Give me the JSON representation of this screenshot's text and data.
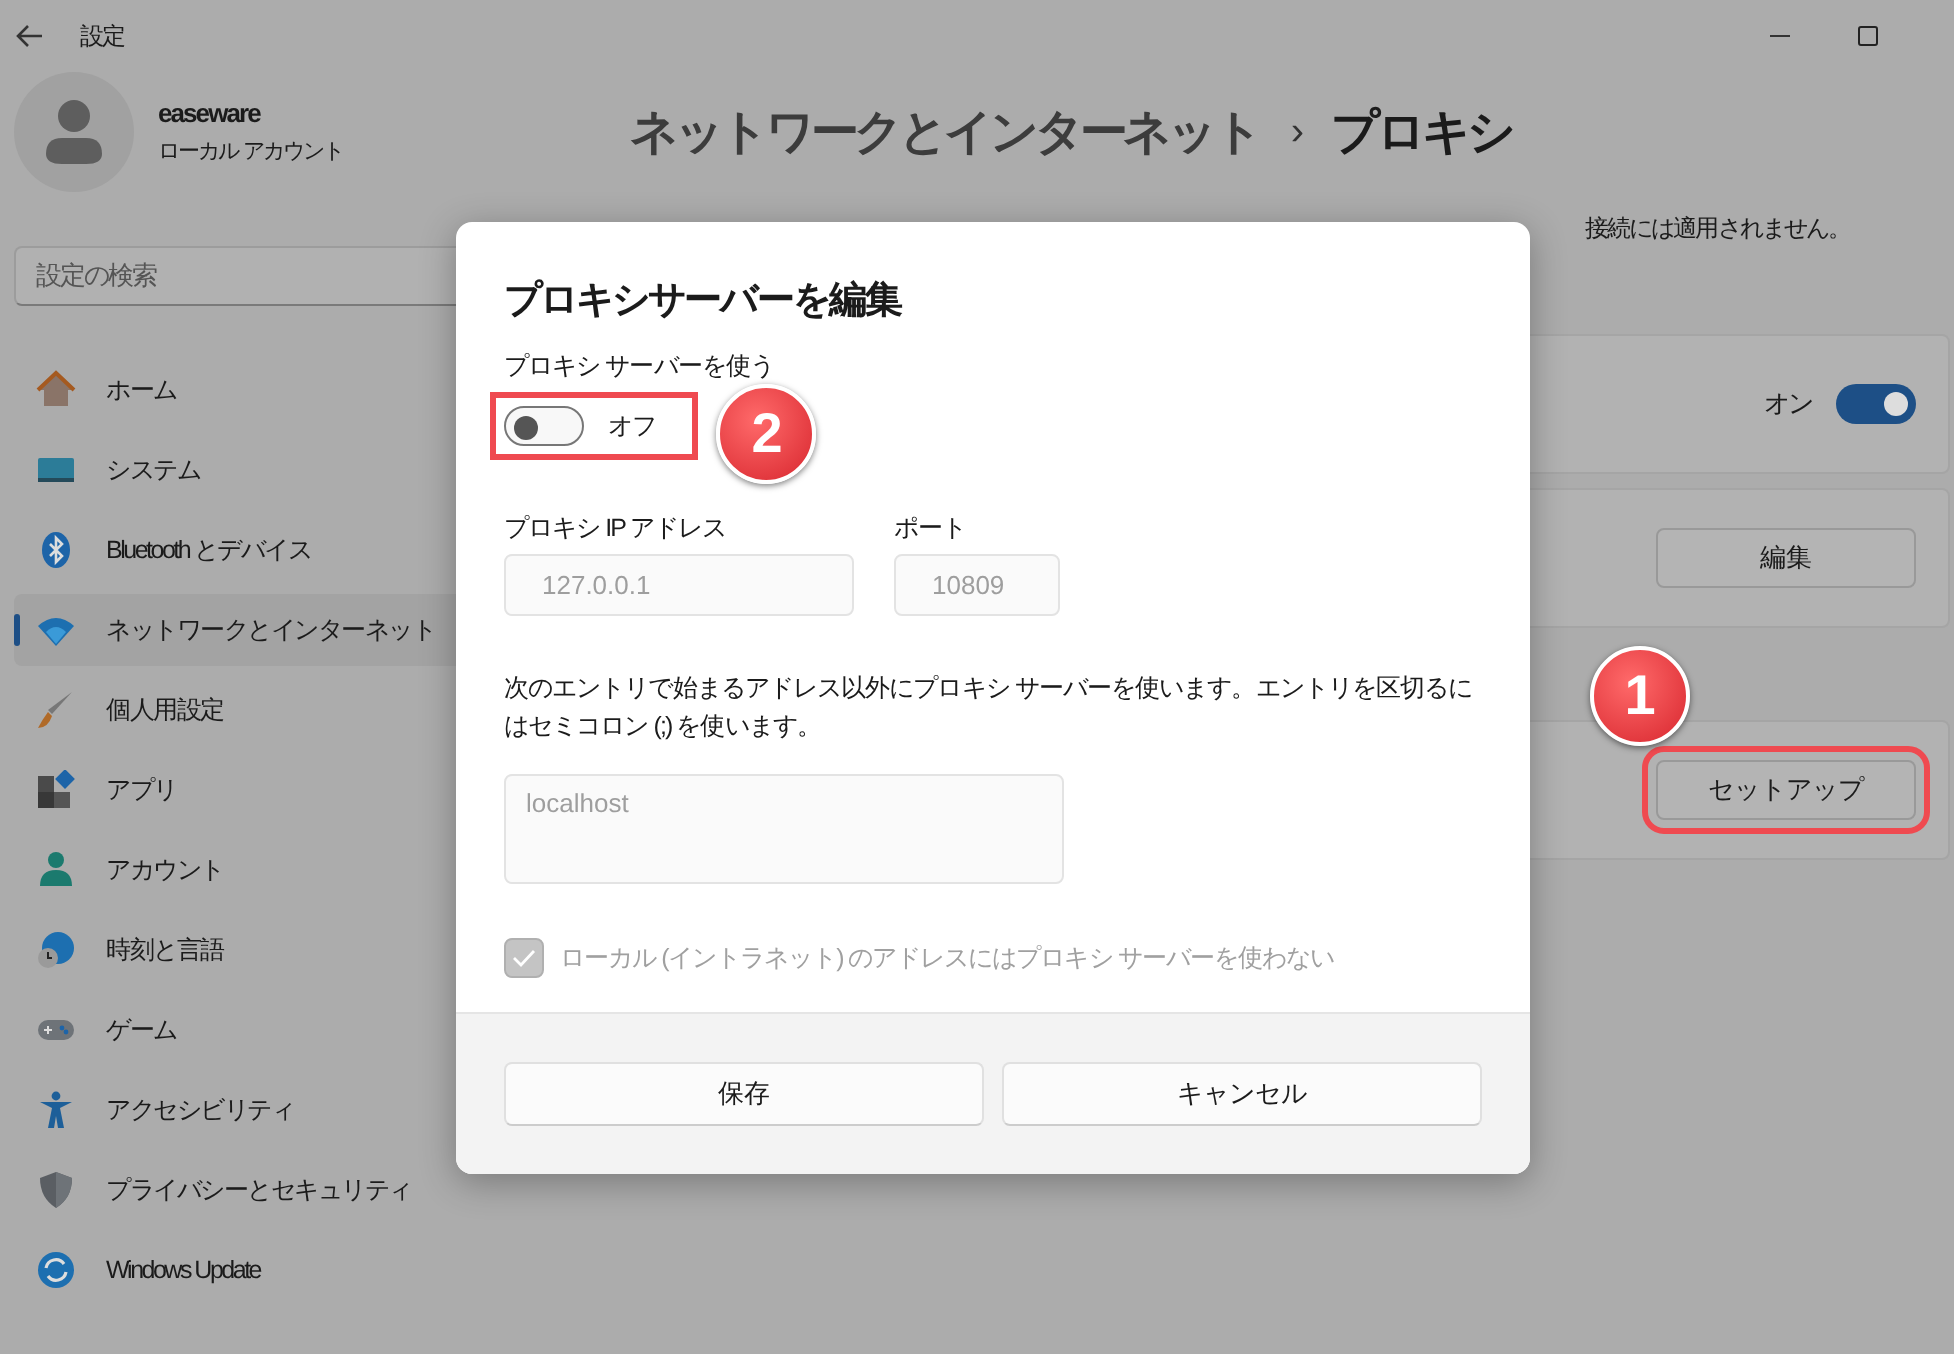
{
  "window": {
    "title": "設定"
  },
  "account": {
    "name": "easeware",
    "type": "ローカル アカウント"
  },
  "search": {
    "placeholder": "設定の検索"
  },
  "sidebar": {
    "items": [
      {
        "label": "ホーム",
        "kind": "home",
        "selected": false
      },
      {
        "label": "システム",
        "kind": "system",
        "selected": false
      },
      {
        "label": "Bluetooth とデバイス",
        "kind": "bluetooth",
        "selected": false
      },
      {
        "label": "ネットワークとインターネット",
        "kind": "network",
        "selected": true
      },
      {
        "label": "個人用設定",
        "kind": "brush",
        "selected": false
      },
      {
        "label": "アプリ",
        "kind": "apps",
        "selected": false
      },
      {
        "label": "アカウント",
        "kind": "account",
        "selected": false
      },
      {
        "label": "時刻と言語",
        "kind": "time",
        "selected": false
      },
      {
        "label": "ゲーム",
        "kind": "game",
        "selected": false
      },
      {
        "label": "アクセシビリティ",
        "kind": "accessibility",
        "selected": false
      },
      {
        "label": "プライバシーとセキュリティ",
        "kind": "privacy",
        "selected": false
      },
      {
        "label": "Windows Update",
        "kind": "update",
        "selected": false
      }
    ]
  },
  "page": {
    "breadcrumb_parent": "ネットワークとインターネット",
    "breadcrumb_separator": "›",
    "title": "プロキシ",
    "description": "接続には適用されません。"
  },
  "cards": [
    {
      "kind": "toggle",
      "state_label": "オン",
      "on": true
    },
    {
      "kind": "button",
      "button": "編集"
    },
    {
      "kind": "button",
      "button": "セットアップ",
      "callout": "1"
    }
  ],
  "dialog": {
    "title": "プロキシサーバーを編集",
    "use_proxy_label": "プロキシ サーバーを使う",
    "use_proxy_on": false,
    "use_proxy_state": "オフ",
    "use_proxy_callout": "2",
    "fields_disabled": true,
    "ip_label": "プロキシ IP アドレス",
    "ip_value": "127.0.0.1",
    "port_label": "ポート",
    "port_value": "10809",
    "exceptions_note": "次のエントリで始まるアドレス以外にプロキシ サーバーを使います。エントリを区切るにはセミコロン (;) を使います。",
    "exceptions_value": "localhost",
    "local_bypass_label": "ローカル (イントラネット) のアドレスにはプロキシ サーバーを使わない",
    "local_bypass_checked": true,
    "buttons": [
      "保存",
      "キャンセル"
    ]
  }
}
